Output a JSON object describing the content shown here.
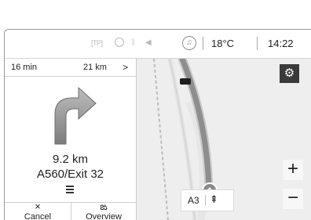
{
  "status_bar": {
    "tp_label": "[TP]",
    "icons": [
      "phone-icon",
      "bluetooth-icon",
      "mute-icon",
      "music-note-icon"
    ],
    "temperature": "18°C",
    "time": "14:22"
  },
  "guidance": {
    "remaining_time": "16 min",
    "remaining_distance": "21 km",
    "details_chevron": ">",
    "maneuver_icon": "turn-right-arrow",
    "maneuver_distance": "9.2 km",
    "maneuver_road": "A560/Exit 32",
    "list_icon": "list-icon"
  },
  "buttons": {
    "cancel_icon": "×",
    "cancel_label": "Cancel",
    "overview_icon": "ఙ",
    "overview_label": "Overview"
  },
  "map": {
    "settings_icon": "⚙",
    "zoom_in": "+",
    "zoom_out": "−",
    "current_road": "A3",
    "lane_icon": "⇞",
    "route_color": "#8e8e8e",
    "vehicle_color": "#8a8a8a"
  }
}
